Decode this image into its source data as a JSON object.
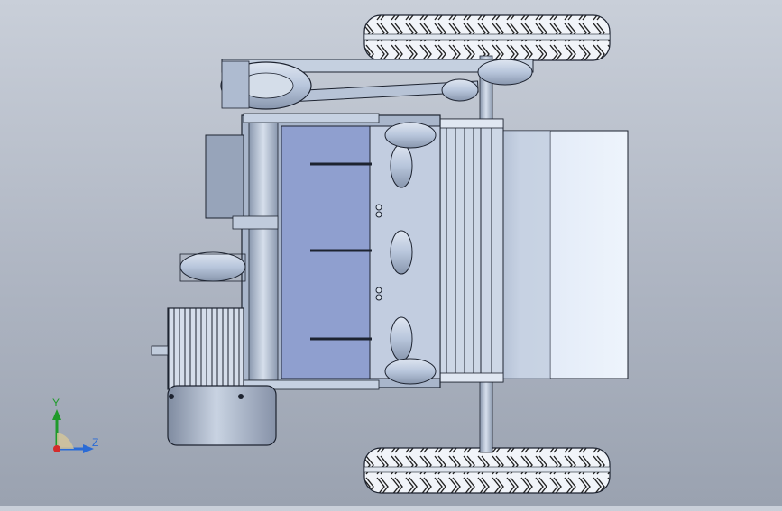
{
  "viewport": {
    "background_top": "#c9cfd9",
    "background_bottom": "#9aa2b0"
  },
  "model": {
    "part_color": "#b8c6dc",
    "part_shadow": "#6f7d94",
    "edge_color": "#1d2330",
    "blue_panel_color": "#8f9fcf",
    "hopper_color": "#e4eefb",
    "tire_color": "#e9eef5"
  },
  "triad": {
    "y_label": "Y",
    "z_label": "Z",
    "y_color": "#1f9a2a",
    "z_color": "#2a6bd6",
    "origin_color": "#d42b2b"
  }
}
